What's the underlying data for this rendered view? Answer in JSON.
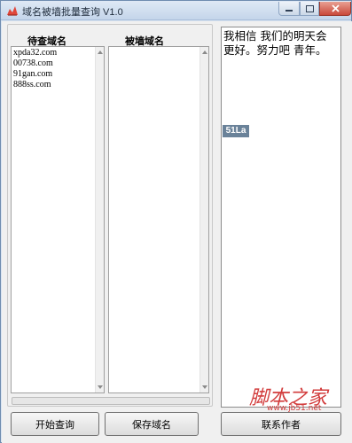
{
  "window": {
    "title": "域名被墙批量查询 V1.0"
  },
  "columns": {
    "pending_label": "待查域名",
    "blocked_label": "被墙域名"
  },
  "pending_domains": [
    "xpda32.com",
    "00738.com",
    "91gan.com",
    "888ss.com"
  ],
  "blocked_domains": [],
  "web_panel": {
    "slogan": "我相信 我们的明天会更好。努力吧 青年。",
    "badge": "51La"
  },
  "buttons": {
    "start": "开始查询",
    "save": "保存域名",
    "contact": "联系作者"
  },
  "progress": {
    "value": 0
  },
  "watermark": {
    "text": "脚本之家",
    "url": "www.jb51.net"
  },
  "colors": {
    "close_button": "#c9483a",
    "watermark": "#d23c3c",
    "badge": "#6a8299"
  }
}
